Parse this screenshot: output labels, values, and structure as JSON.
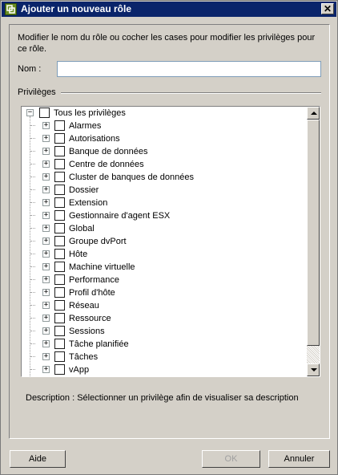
{
  "window": {
    "title": "Ajouter un nouveau rôle",
    "close_label": "✕"
  },
  "instructions": "Modifier le nom du rôle ou cocher les cases pour modifier les privilèges pour ce rôle.",
  "name_field": {
    "label": "Nom :",
    "value": ""
  },
  "privileges": {
    "label": "Privilèges",
    "root": {
      "label": "Tous les privilèges",
      "expander": "−",
      "checked": false
    },
    "items": [
      {
        "label": "Alarmes",
        "expander": "+"
      },
      {
        "label": "Autorisations",
        "expander": "+"
      },
      {
        "label": "Banque de données",
        "expander": "+"
      },
      {
        "label": "Centre de données",
        "expander": "+"
      },
      {
        "label": "Cluster de banques de données",
        "expander": "+"
      },
      {
        "label": "Dossier",
        "expander": "+"
      },
      {
        "label": "Extension",
        "expander": "+"
      },
      {
        "label": "Gestionnaire d'agent ESX",
        "expander": "+"
      },
      {
        "label": "Global",
        "expander": "+"
      },
      {
        "label": "Groupe dvPort",
        "expander": "+"
      },
      {
        "label": "Hôte",
        "expander": "+"
      },
      {
        "label": "Machine virtuelle",
        "expander": "+"
      },
      {
        "label": "Performance",
        "expander": "+"
      },
      {
        "label": "Profil d'hôte",
        "expander": "+"
      },
      {
        "label": "Réseau",
        "expander": "+"
      },
      {
        "label": "Ressource",
        "expander": "+"
      },
      {
        "label": "Sessions",
        "expander": "+"
      },
      {
        "label": "Tâche planifiée",
        "expander": "+"
      },
      {
        "label": "Tâches",
        "expander": "+"
      },
      {
        "label": "vApp",
        "expander": "+"
      },
      {
        "label": "",
        "expander": "+"
      }
    ]
  },
  "description": "Description : Sélectionner un privilège afin de visualiser sa description",
  "buttons": {
    "help": "Aide",
    "ok": "OK",
    "cancel": "Annuler"
  },
  "colors": {
    "titlebar": "#0a246a",
    "dialog": "#d4d0c8"
  }
}
